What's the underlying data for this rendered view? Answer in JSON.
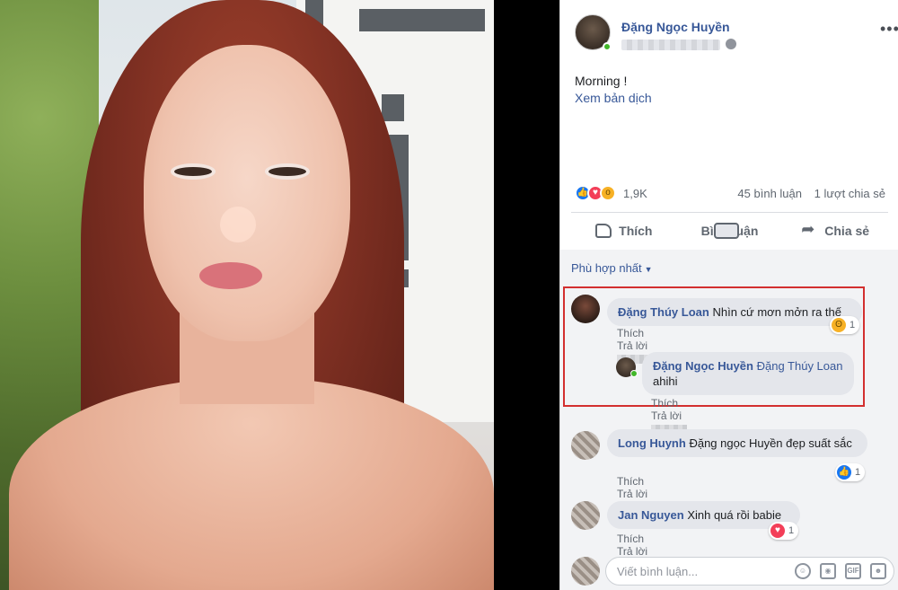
{
  "post": {
    "author": "Đặng Ngọc Huyền",
    "text": "Morning !",
    "translate_link": "Xem bản dịch",
    "reaction_count": "1,9K",
    "comments_count": "45 bình luận",
    "shares_count": "1 lượt chia sẻ",
    "reaction_icons": [
      "like-icon",
      "love-icon",
      "wow-icon"
    ]
  },
  "actions": {
    "like": "Thích",
    "comment": "Bình luận",
    "share": "Chia sẻ"
  },
  "comments": {
    "sort_label": "Phù hợp nhất",
    "items": [
      {
        "name": "Đặng Thúy Loan",
        "text": "Nhìn cứ mơn mởn ra thế",
        "reaction_count": "1",
        "reaction_icon": "haha-icon",
        "like": "Thích",
        "reply": "Trả lời",
        "reply_item": {
          "name": "Đặng Ngọc Huyền",
          "tag": "Đặng Thúy Loan",
          "text": "ahihi",
          "like": "Thích",
          "reply": "Trả lời"
        }
      },
      {
        "name": "Long Huynh",
        "text": "Đặng ngọc Huyền đẹp suất sắc",
        "reaction_count": "1",
        "reaction_icon": "like-icon",
        "like": "Thích",
        "reply": "Trả lời"
      },
      {
        "name": "Jan Nguyen",
        "text": "Xinh quá rồi babie",
        "reaction_count": "1",
        "reaction_icon": "love-icon",
        "like": "Thích",
        "reply": "Trả lời"
      }
    ]
  },
  "composer": {
    "placeholder": "Viết bình luận...",
    "icons": [
      "emoji-icon",
      "camera-icon",
      "gif-icon",
      "sticker-icon"
    ]
  },
  "colors": {
    "link": "#385898",
    "highlight": "#d32f2f",
    "online": "#42b72a"
  }
}
